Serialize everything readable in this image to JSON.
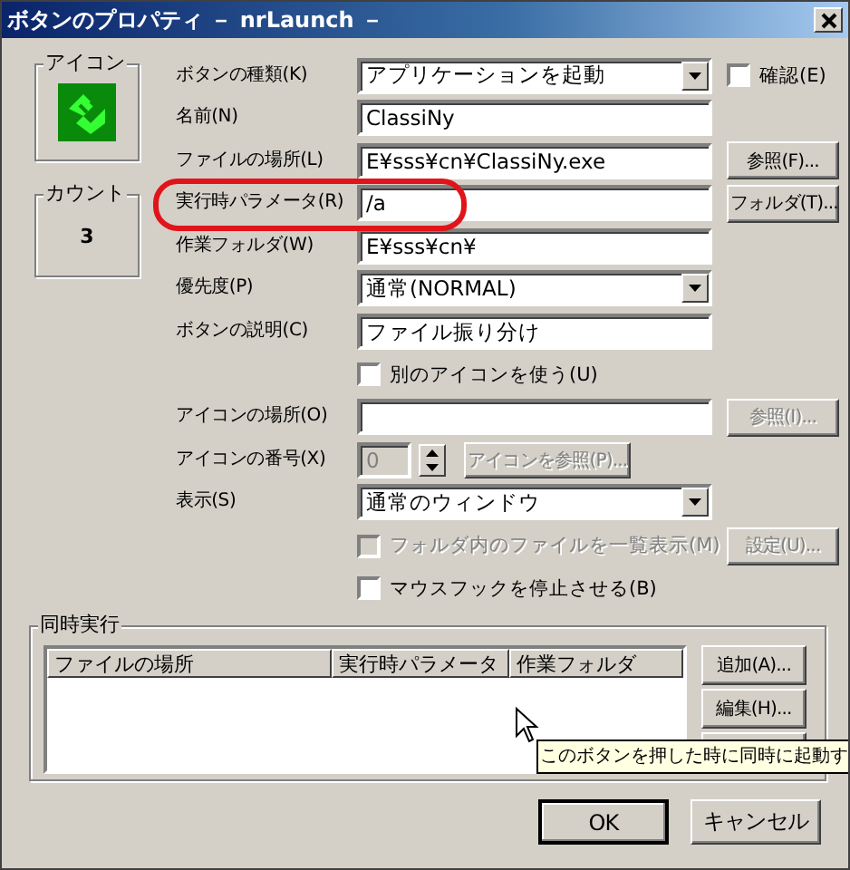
{
  "window": {
    "title": "ボタンのプロパティ － nrLaunch －"
  },
  "icon_group": {
    "title": "アイコン"
  },
  "count_group": {
    "title": "カウント",
    "value": "3"
  },
  "rows": [
    {
      "kind": "dropdown",
      "label": "ボタンの種類(K)",
      "value": "アプリケーションを起動",
      "checkbox": {
        "label": "確認(E)",
        "checked": false
      }
    },
    {
      "kind": "text",
      "label": "名前(N)",
      "value": "ClassiNy"
    },
    {
      "kind": "text",
      "label": "ファイルの場所(L)",
      "value": "E¥sss¥cn¥ClassiNy.exe",
      "button": {
        "label": "参照(F)...",
        "disabled": false
      }
    },
    {
      "kind": "text",
      "label": "実行時パラメータ(R)",
      "value": "/a",
      "button": {
        "label": "フォルダ(T)...",
        "disabled": false
      }
    },
    {
      "kind": "text",
      "label": "作業フォルダ(W)",
      "value": "E¥sss¥cn¥"
    },
    {
      "kind": "dropdown",
      "label": "優先度(P)",
      "value": "通常(NORMAL)"
    },
    {
      "kind": "text",
      "label": "ボタンの説明(C)",
      "value": "ファイル振り分け"
    },
    {
      "kind": "check",
      "label": "別のアイコンを使う(U)",
      "checked": false,
      "disabled": false
    },
    {
      "kind": "text",
      "label": "アイコンの場所(O)",
      "button": {
        "label": "参照(I)...",
        "disabled": true
      }
    },
    {
      "kind": "spin",
      "label": "アイコンの番号(X)",
      "value": "0",
      "disabled": true,
      "button": {
        "label": "アイコンを参照(P)...",
        "disabled": true
      }
    },
    {
      "kind": "dropdown",
      "label": "表示(S)",
      "value": "通常のウィンドウ"
    },
    {
      "kind": "check",
      "label": "フォルダ内のファイルを一覧表示(M)",
      "checked": false,
      "disabled": true,
      "button": {
        "label": "設定(U)...",
        "disabled": true
      }
    },
    {
      "kind": "check",
      "label": "マウスフックを停止させる(B)",
      "checked": false,
      "disabled": false
    }
  ],
  "concurrent": {
    "title": "同時実行",
    "columns": [
      "ファイルの場所",
      "実行時パラメータ",
      "作業フォルダ"
    ],
    "buttons": [
      "追加(A)...",
      "編集(H)..."
    ]
  },
  "tooltip": "このボタンを押した時に同時に起動す",
  "buttons": [
    {
      "label": "OK",
      "default": true
    },
    {
      "label": "キャンセル",
      "default": false
    }
  ]
}
